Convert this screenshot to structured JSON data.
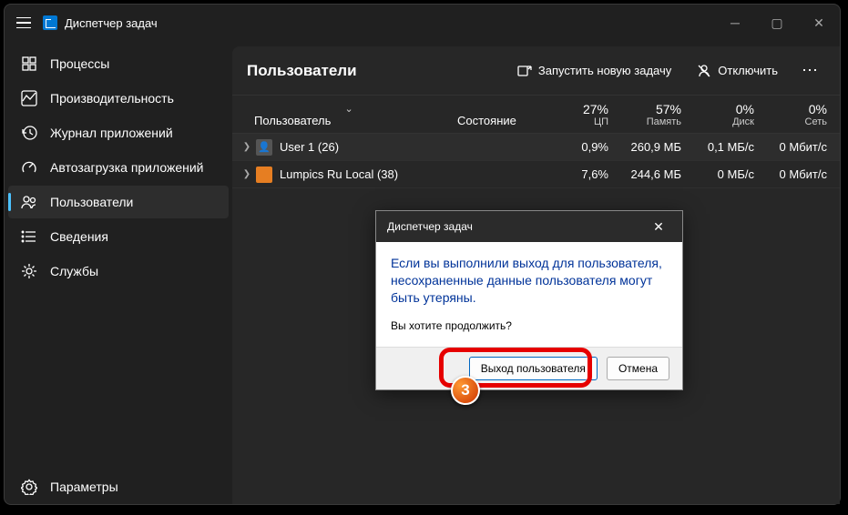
{
  "title": "Диспетчер задач",
  "sidebar": {
    "items": [
      {
        "label": "Процессы"
      },
      {
        "label": "Производительность"
      },
      {
        "label": "Журнал приложений"
      },
      {
        "label": "Автозагрузка приложений"
      },
      {
        "label": "Пользователи"
      },
      {
        "label": "Сведения"
      },
      {
        "label": "Службы"
      }
    ],
    "settings": "Параметры"
  },
  "header": {
    "title": "Пользователи",
    "new_task": "Запустить новую задачу",
    "disconnect": "Отключить"
  },
  "columns": {
    "user": "Пользователь",
    "state": "Состояние",
    "cpu_pct": "27%",
    "cpu_lbl": "ЦП",
    "mem_pct": "57%",
    "mem_lbl": "Память",
    "disk_pct": "0%",
    "disk_lbl": "Диск",
    "net_pct": "0%",
    "net_lbl": "Сеть"
  },
  "rows": [
    {
      "name": "User 1 (26)",
      "cpu": "0,9%",
      "mem": "260,9 МБ",
      "disk": "0,1 МБ/с",
      "net": "0 Мбит/с"
    },
    {
      "name": "Lumpics Ru Local (38)",
      "cpu": "7,6%",
      "mem": "244,6 МБ",
      "disk": "0 МБ/с",
      "net": "0 Мбит/с"
    }
  ],
  "dialog": {
    "title": "Диспетчер задач",
    "main": "Если вы выполнили выход для пользователя, несохраненные данные пользователя могут быть утеряны.",
    "sub": "Вы хотите продолжить?",
    "ok": "Выход пользователя",
    "cancel": "Отмена"
  },
  "step": "3"
}
